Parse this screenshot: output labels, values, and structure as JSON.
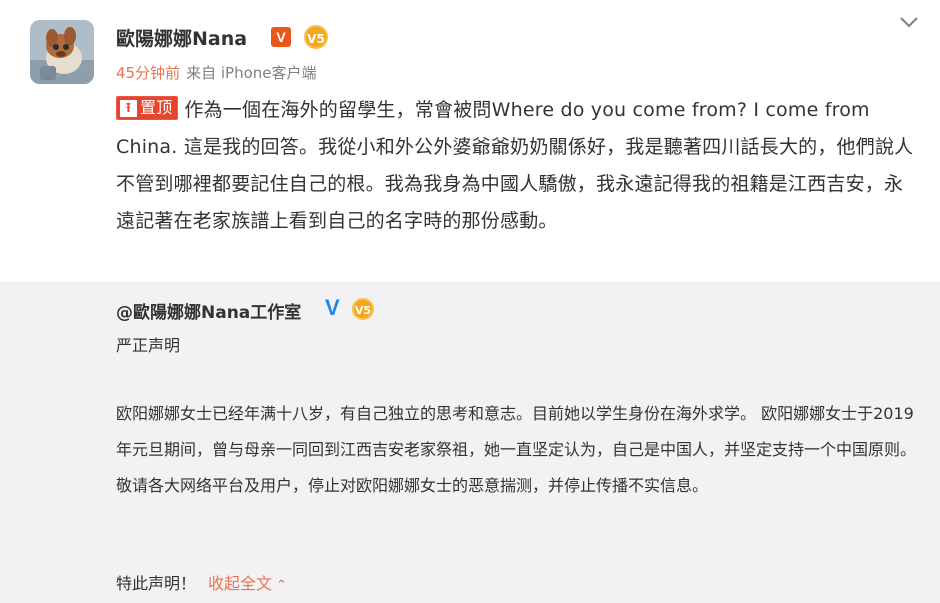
{
  "post": {
    "username": "歐陽娜娜Nana",
    "verified_badge": "V",
    "medal_text": "V5",
    "time": "45分钟前",
    "source": "来自 iPhone客户端",
    "pin_label": "置顶",
    "text": "作為一個在海外的留學生，常會被問Where do you come from? I come from China. 這是我的回答。我從小和外公外婆爺爺奶奶關係好，我是聽著四川話長大的，他們說人不管到哪裡都要記住自己的根。我為我身為中國人驕傲，我永遠記得我的祖籍是江西吉安，永遠記著在老家族譜上看到自己的名字時的那份感動。"
  },
  "repost": {
    "username": "@歐陽娜娜Nana工作室",
    "verified_badge": "V",
    "medal_text": "V5",
    "title": "严正声明",
    "body": "欧阳娜娜女士已经年满十八岁，有自己独立的思考和意志。目前她以学生身份在海外求学。 欧阳娜娜女士于2019年元旦期间，曾与母亲一同回到江西吉安老家祭祖，她一直坚定认为，自己是中国人，并坚定支持一个中国原则。 敬请各大网络平台及用户，停止对欧阳娜娜女士的恶意揣测，并停止传播不实信息。",
    "closing": "特此声明！",
    "collapse_label": "收起全文"
  },
  "icons": {
    "menu": "chevron-down-icon",
    "pin": "pin-top-icon",
    "collapse": "chevron-up-icon"
  },
  "colors": {
    "accent_orange": "#eb7350",
    "pin_red": "#e8452e",
    "verified_orange": "#e8571c",
    "verified_blue": "#1f8ae6",
    "repost_bg": "#f2f2f5"
  }
}
